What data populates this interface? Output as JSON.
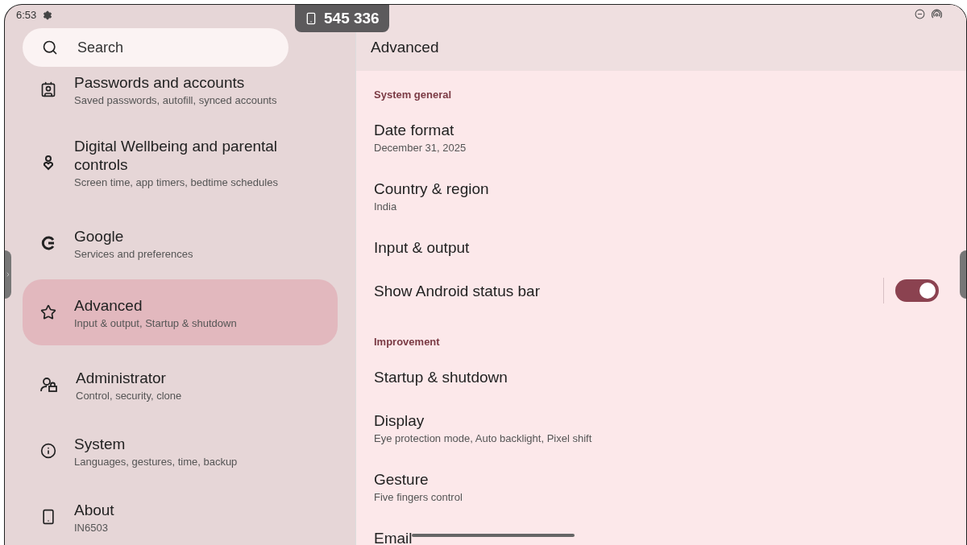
{
  "status_bar": {
    "time": "6:53"
  },
  "cast_badge": {
    "code": "545 336"
  },
  "search": {
    "placeholder": "Search"
  },
  "sidebar": {
    "items": [
      {
        "title": "Passwords and accounts",
        "subtitle": "Saved passwords, autofill, synced accounts",
        "selected": false
      },
      {
        "title": "Digital Wellbeing and parental controls",
        "subtitle": "Screen time, app timers, bedtime schedules",
        "selected": false
      },
      {
        "title": "Google",
        "subtitle": "Services and preferences",
        "selected": false
      },
      {
        "title": "Advanced",
        "subtitle": "Input & output, Startup & shutdown",
        "selected": true
      },
      {
        "title": "Administrator",
        "subtitle": "Control, security, clone",
        "selected": false
      },
      {
        "title": "System",
        "subtitle": "Languages, gestures, time, backup",
        "selected": false
      },
      {
        "title": "About",
        "subtitle": "IN6503",
        "selected": false
      }
    ]
  },
  "detail": {
    "title": "Advanced",
    "sections": [
      {
        "heading": "System general",
        "items": [
          {
            "kind": "link",
            "title": "Date format",
            "subtitle": "December 31, 2025"
          },
          {
            "kind": "link",
            "title": "Country & region",
            "subtitle": "India"
          },
          {
            "kind": "link",
            "title": "Input & output"
          },
          {
            "kind": "toggle",
            "title": "Show Android status bar",
            "on": true
          }
        ]
      },
      {
        "heading": "Improvement",
        "items": [
          {
            "kind": "link",
            "title": "Startup & shutdown"
          },
          {
            "kind": "link",
            "title": "Display",
            "subtitle": "Eye protection mode, Auto backlight, Pixel shift"
          },
          {
            "kind": "link",
            "title": "Gesture",
            "subtitle": "Five fingers control"
          },
          {
            "kind": "link",
            "title": "Email"
          }
        ]
      }
    ]
  }
}
